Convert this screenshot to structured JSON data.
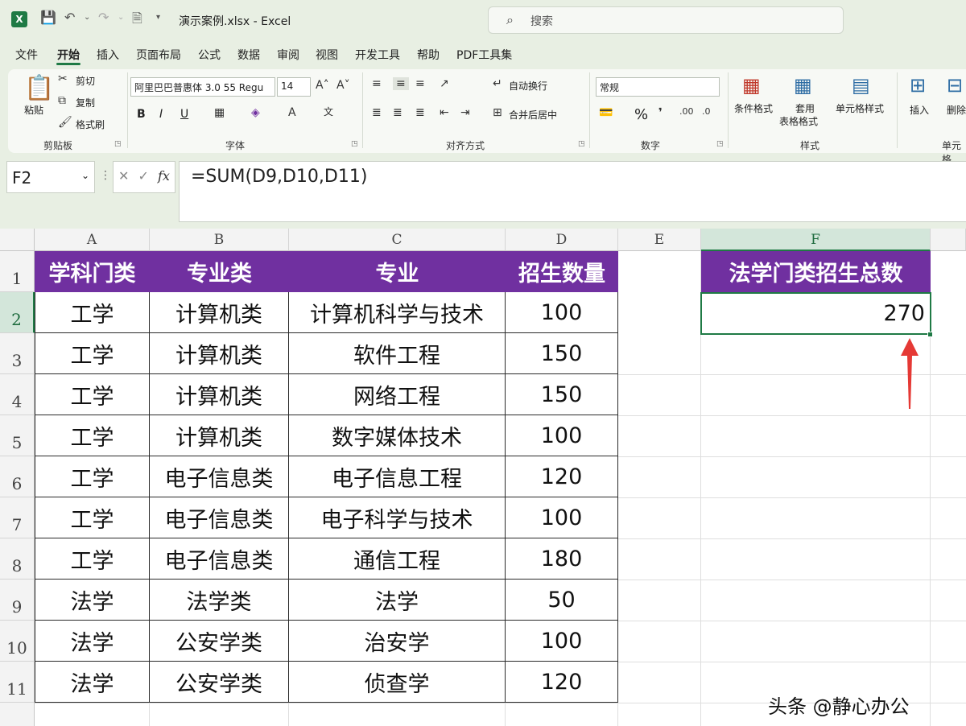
{
  "titlebar": {
    "doc_title": "演示案例.xlsx  -  Excel",
    "search_placeholder": "搜索"
  },
  "menu": [
    "文件",
    "开始",
    "插入",
    "页面布局",
    "公式",
    "数据",
    "审阅",
    "视图",
    "开发工具",
    "帮助",
    "PDF工具集"
  ],
  "ribbon": {
    "clipboard": {
      "paste": "粘贴",
      "cut": "剪切",
      "copy": "复制",
      "format_painter": "格式刷",
      "label": "剪贴板"
    },
    "font": {
      "name": "阿里巴巴普惠体 3.0 55 Regu",
      "size": "14",
      "bold": "B",
      "italic": "I",
      "underline": "U",
      "label": "字体"
    },
    "align": {
      "wrap": "自动换行",
      "merge": "合并后居中",
      "label": "对齐方式"
    },
    "number": {
      "format": "常规",
      "percent": "%",
      "label": "数字"
    },
    "styles": {
      "cond": "条件格式",
      "table": "套用",
      "table2": "表格格式",
      "cell": "单元格样式",
      "label": "样式"
    },
    "cells": {
      "insert": "插入",
      "delete": "删除",
      "label": "单元格"
    }
  },
  "formula_bar": {
    "name_box": "F2",
    "fx": "fx",
    "formula": "=SUM(D9,D10,D11)"
  },
  "columns": [
    "A",
    "B",
    "C",
    "D",
    "E",
    "F"
  ],
  "rows": [
    "1",
    "2",
    "3",
    "4",
    "5",
    "6",
    "7",
    "8",
    "9",
    "10",
    "11"
  ],
  "table": {
    "headers": [
      "学科门类",
      "专业类",
      "专业",
      "招生数量"
    ],
    "rows": [
      [
        "工学",
        "计算机类",
        "计算机科学与技术",
        "100"
      ],
      [
        "工学",
        "计算机类",
        "软件工程",
        "150"
      ],
      [
        "工学",
        "计算机类",
        "网络工程",
        "150"
      ],
      [
        "工学",
        "计算机类",
        "数字媒体技术",
        "100"
      ],
      [
        "工学",
        "电子信息类",
        "电子信息工程",
        "120"
      ],
      [
        "工学",
        "电子信息类",
        "电子科学与技术",
        "100"
      ],
      [
        "工学",
        "电子信息类",
        "通信工程",
        "180"
      ],
      [
        "法学",
        "法学类",
        "法学",
        "50"
      ],
      [
        "法学",
        "公安学类",
        "治安学",
        "100"
      ],
      [
        "法学",
        "公安学类",
        "侦查学",
        "120"
      ]
    ]
  },
  "summary": {
    "header": "法学门类招生总数",
    "value": "270"
  },
  "watermark": "头条 @静心办公",
  "colors": {
    "header_bg": "#7030a0",
    "accent": "#1f7a45",
    "arrow": "#e53935"
  }
}
